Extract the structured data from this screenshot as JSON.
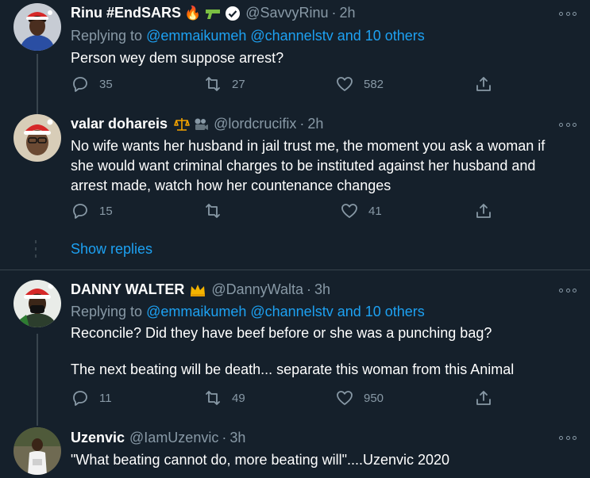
{
  "tweets": [
    {
      "name": "Rinu #EndSARS",
      "emojis": [
        "🔥",
        "🔫",
        "✔"
      ],
      "handle": "@SavvyRinu",
      "sep": "·",
      "time": "2h",
      "replying_prefix": "Replying to ",
      "mentions": "@emmaikumeh @channelstv and 10 others",
      "text": "Person wey dem suppose arrest?",
      "replies": "35",
      "retweets": "27",
      "likes": "582"
    },
    {
      "name": "valar dohareis",
      "emojis": [
        "⚖",
        "🎥"
      ],
      "handle": "@lordcrucifix",
      "sep": "·",
      "time": "2h",
      "text": "No wife wants her husband in jail trust me, the moment you ask a woman if she would want criminal charges to be instituted against her husband and arrest made, watch how her countenance changes",
      "replies": "15",
      "retweets": "",
      "likes": "41"
    },
    {
      "name": "DANNY WALTER",
      "emojis": [
        "👑"
      ],
      "handle": "@DannyWalta",
      "sep": "·",
      "time": "3h",
      "replying_prefix": "Replying to ",
      "mentions": "@emmaikumeh @channelstv and 10 others",
      "text_line1": "Reconcile? Did they have beef before or she was a punching bag?",
      "text_line2": "The next beating will be death... separate this woman from this Animal",
      "replies": "11",
      "retweets": "49",
      "likes": "950"
    },
    {
      "name": "Uzenvic",
      "handle": "@IamUzenvic",
      "sep": "·",
      "time": "3h",
      "text": "\"What beating cannot do, more beating will\"....Uzenvic 2020"
    }
  ],
  "show_replies": "Show replies",
  "icons": [
    "reply-icon",
    "retweet-icon",
    "like-icon",
    "share-icon",
    "more-icon",
    "verified-icon"
  ],
  "colors": {
    "background": "#15202b",
    "accent": "#1da1f2",
    "muted": "#8899a6",
    "divider": "#38444d"
  }
}
